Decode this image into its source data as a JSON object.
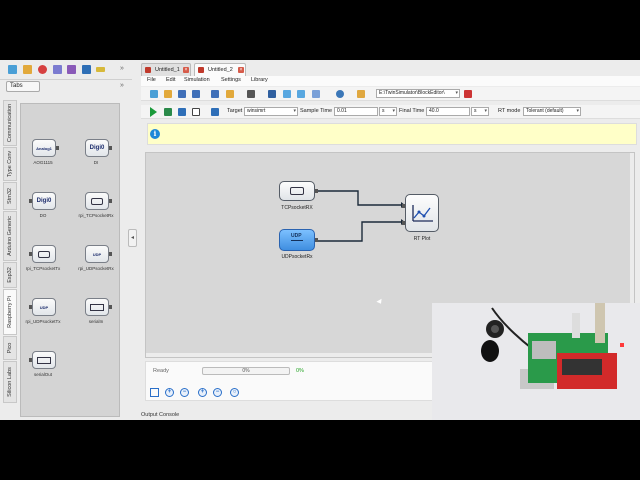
{
  "left_panel": {
    "tabs_button": "Tabs",
    "vertical_tabs": [
      "Communication",
      "Type Conv",
      "Stm32",
      "Arduino Generic",
      "Esp32",
      "Raspberry Pi",
      "Pico",
      "Silicon Labs"
    ],
    "active_tab": "Raspberry Pi",
    "palette_items": [
      {
        "name": "AOG1115",
        "text": "Analog1"
      },
      {
        "name": "DI",
        "text": "Digi0"
      },
      {
        "name": "DO",
        "text": "Digi0"
      },
      {
        "name": "rpi_TCPsocketRx",
        "text": ""
      },
      {
        "name": "rpi_TCPsocketTx",
        "text": ""
      },
      {
        "name": "rpi_UDPsocketRx",
        "text": "UDP"
      },
      {
        "name": "rpi_UDPsocketTx",
        "text": "UDP"
      },
      {
        "name": "serialIn",
        "text": ""
      },
      {
        "name": "serialOut",
        "text": ""
      }
    ]
  },
  "doc_tabs": [
    {
      "label": "Untitled_1",
      "active": false
    },
    {
      "label": "Untitled_2",
      "active": true
    }
  ],
  "menu": [
    "File",
    "Edit",
    "Simulation",
    "Settings",
    "Library"
  ],
  "toolbar1": {
    "path": "E:\\TwinSimulator\\BlockEditor\\"
  },
  "toolbar2": {
    "target_label": "Target",
    "target_value": "winsimrt",
    "sample_time_label": "Sample Time",
    "sample_time_value": "0.01",
    "sample_time_unit": "s",
    "final_time_label": "Final Time",
    "final_time_value": "40.0",
    "final_time_unit": "s",
    "rt_mode_label": "RT mode",
    "rt_mode_value": "Tolerant (default)"
  },
  "diagram": {
    "blocks": [
      {
        "id": "tcp",
        "label": "TCPsocketRX",
        "icon": "TCP",
        "selected": false
      },
      {
        "id": "udp",
        "label": "UDPsocketRx",
        "icon": "UDP",
        "selected": true
      },
      {
        "id": "plot",
        "label": "RT Plot",
        "icon": "plot-icon",
        "selected": false
      }
    ]
  },
  "status": {
    "state": "Ready",
    "progress_bar": "0%",
    "progress_value": 0,
    "progress_text": "0%"
  },
  "output_console_label": "Output Console",
  "colors": {
    "accent": "#1e88d8",
    "selected_block": "#5aa7f0",
    "info_bar": "#ffffc8",
    "progress_text": "#22a322"
  }
}
